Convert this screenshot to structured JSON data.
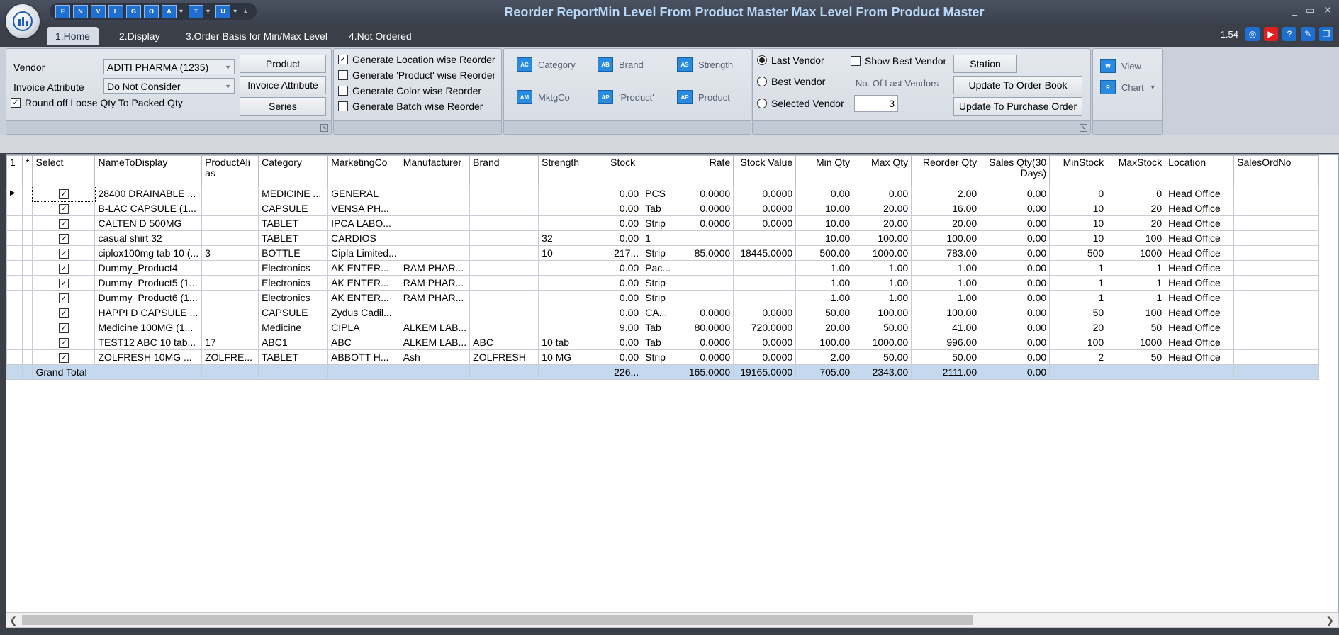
{
  "window": {
    "title": "Reorder ReportMin Level From Product Master Max Level From Product Master",
    "minimize": "_",
    "maximize": "▭",
    "close": "✕"
  },
  "quick_access": {
    "buttons": [
      "F",
      "N",
      "V",
      "L",
      "G",
      "O",
      "A",
      "T",
      "U"
    ]
  },
  "tabs": [
    "1.Home",
    "2.Display",
    "3.Order Basis for Min/Max Level",
    "4.Not Ordered"
  ],
  "version": "1.54",
  "vendor_panel": {
    "vendor_label": "Vendor",
    "vendor_value": "ADITI PHARMA (1235)",
    "invoice_attr_label": "Invoice Attribute",
    "invoice_attr_value": "Do Not Consider",
    "round_off_label": "Round off Loose Qty To Packed Qty",
    "product_btn": "Product",
    "invoice_attr_btn": "Invoice Attribute",
    "series_btn": "Series"
  },
  "generate_panel": {
    "location_wise": "Generate Location wise Reorder",
    "product_wise": "Generate 'Product' wise Reorder",
    "color_wise": "Generate Color wise Reorder",
    "batch_wise": "Generate Batch wise Reorder"
  },
  "group_panel": {
    "category": "Category",
    "brand": "Brand",
    "strength": "Strength",
    "mktgco": "MktgCo",
    "product_q": "'Product'",
    "product": "Product"
  },
  "vendor_select": {
    "last_vendor": "Last Vendor",
    "best_vendor": "Best Vendor",
    "selected_vendor": "Selected Vendor",
    "show_best_vendor": "Show Best Vendor",
    "no_last_vendors_label": "No. Of Last Vendors",
    "no_last_vendors_value": "3",
    "station_btn": "Station",
    "update_order_book_btn": "Update To Order Book",
    "update_purchase_order_btn": "Update To Purchase Order"
  },
  "view_panel": {
    "view": "View",
    "chart": "Chart"
  },
  "grid": {
    "headers": [
      "1",
      "*",
      "Select",
      "NameToDisplay",
      "ProductAlias",
      "Category",
      "MarketingCo",
      "Manufacturer",
      "Brand",
      "Strength",
      "Stock",
      "",
      "Rate",
      "Stock Value",
      "Min Qty",
      "Max Qty",
      "Reorder Qty",
      "Sales Qty(30 Days)",
      "MinStock",
      "MaxStock",
      "Location",
      "SalesOrdNo"
    ],
    "rows": [
      [
        "28400 DRAINABLE ...",
        "",
        "MEDICINE ...",
        "GENERAL",
        "",
        "",
        "",
        "0.00",
        "PCS",
        "0.0000",
        "0.0000",
        "0.00",
        "0.00",
        "2.00",
        "0.00",
        "0",
        "0",
        "Head Office",
        ""
      ],
      [
        "B-LAC CAPSULE (1...",
        "",
        "CAPSULE",
        " VENSA PH...",
        "",
        "",
        "",
        "0.00",
        "Tab",
        "0.0000",
        "0.0000",
        "10.00",
        "20.00",
        "16.00",
        "0.00",
        "10",
        "20",
        "Head Office",
        ""
      ],
      [
        "CALTEN D 500MG",
        "",
        "TABLET",
        " IPCA LABO...",
        "",
        "",
        "",
        "0.00",
        "Strip",
        "0.0000",
        "0.0000",
        "10.00",
        "20.00",
        "20.00",
        "0.00",
        "10",
        "20",
        "Head Office",
        ""
      ],
      [
        "casual shirt 32",
        "",
        "TABLET",
        " CARDIOS",
        "",
        "",
        "32",
        "0.00",
        "1",
        "",
        "",
        "10.00",
        "100.00",
        "100.00",
        "0.00",
        "10",
        "100",
        "Head Office",
        ""
      ],
      [
        "ciplox100mg tab 10 (...",
        "3",
        "BOTTLE",
        "Cipla Limited...",
        "",
        "",
        "10",
        "217...",
        "Strip",
        "85.0000",
        "18445.0000",
        "500.00",
        "1000.00",
        "783.00",
        "0.00",
        "500",
        "1000",
        "Head Office",
        ""
      ],
      [
        "Dummy_Product4",
        "",
        "Electronics",
        "AK ENTER...",
        "RAM PHAR...",
        "",
        "",
        "0.00",
        "Pac...",
        "",
        "",
        "1.00",
        "1.00",
        "1.00",
        "0.00",
        "1",
        "1",
        "Head Office",
        ""
      ],
      [
        "Dummy_Product5 (1...",
        "",
        "Electronics",
        "AK ENTER...",
        "RAM PHAR...",
        "",
        "",
        "0.00",
        "Strip",
        "",
        "",
        "1.00",
        "1.00",
        "1.00",
        "0.00",
        "1",
        "1",
        "Head Office",
        ""
      ],
      [
        "Dummy_Product6 (1...",
        "",
        "Electronics",
        "AK ENTER...",
        "RAM PHAR...",
        "",
        "",
        "0.00",
        "Strip",
        "",
        "",
        "1.00",
        "1.00",
        "1.00",
        "0.00",
        "1",
        "1",
        "Head Office",
        ""
      ],
      [
        "HAPPI D CAPSULE ...",
        "",
        "CAPSULE",
        "Zydus Cadil...",
        "",
        "",
        "",
        "0.00",
        "CA...",
        "0.0000",
        "0.0000",
        "50.00",
        "100.00",
        "100.00",
        "0.00",
        "50",
        "100",
        "Head Office",
        ""
      ],
      [
        "Medicine  100MG (1...",
        "",
        "Medicine",
        "CIPLA",
        "ALKEM LAB...",
        "",
        "",
        "9.00",
        "Tab",
        "80.0000",
        "720.0000",
        "20.00",
        "50.00",
        "41.00",
        "0.00",
        "20",
        "50",
        "Head Office",
        ""
      ],
      [
        "TEST12 ABC 10 tab...",
        "17",
        "ABC1",
        "ABC",
        "ALKEM LAB...",
        "ABC",
        "10 tab",
        "0.00",
        "Tab",
        "0.0000",
        "0.0000",
        "100.00",
        "1000.00",
        "996.00",
        "0.00",
        "100",
        "1000",
        "Head Office",
        ""
      ],
      [
        "ZOLFRESH 10MG ...",
        "ZOLFRE...",
        "TABLET",
        "ABBOTT H...",
        "Ash",
        "ZOLFRESH",
        "10 MG",
        "0.00",
        "Strip",
        "0.0000",
        "0.0000",
        "2.00",
        "50.00",
        "50.00",
        "0.00",
        "2",
        "50",
        "Head Office",
        ""
      ]
    ],
    "total": {
      "label": "Grand Total",
      "stock": "226...",
      "rate": "165.0000",
      "stock_value": "19165.0000",
      "min_qty": "705.00",
      "max_qty": "2343.00",
      "reorder_qty": "2111.00",
      "sales_qty": "0.00"
    }
  }
}
